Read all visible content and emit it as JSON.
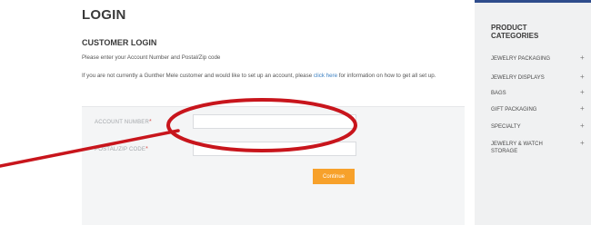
{
  "page": {
    "title": "LOGIN",
    "section_title": "CUSTOMER LOGIN",
    "instructions": "Please enter your Account Number and Postal/Zip code",
    "info_text": "If you are not currently a Gunther Mele customer and would like to set up an account, please",
    "info_link": "click here",
    "info_text_after": "for information on how to get all set up."
  },
  "form": {
    "account_label": "ACCOUNT NUMBER",
    "postal_label": "POSTAL/ZIP CODE",
    "required_mark": "*",
    "account_value": "",
    "postal_value": "",
    "continue_label": "Continue"
  },
  "sidebar": {
    "title": "PRODUCT CATEGORIES",
    "items": [
      {
        "label": "JEWELRY PACKAGING",
        "expand": "+"
      },
      {
        "label": "JEWELRY DISPLAYS",
        "expand": "+"
      },
      {
        "label": "BAGS",
        "expand": "+"
      },
      {
        "label": "GIFT PACKAGING",
        "expand": "+"
      },
      {
        "label": "SPECIALTY",
        "expand": "+"
      },
      {
        "label": "JEWELRY & WATCH STORAGE",
        "expand": "+"
      }
    ]
  },
  "colors": {
    "accent_button": "#f7a12b",
    "annotation_red": "#c8151c",
    "link": "#3a7fc1",
    "sidebar_accent": "#2e4c8c"
  }
}
